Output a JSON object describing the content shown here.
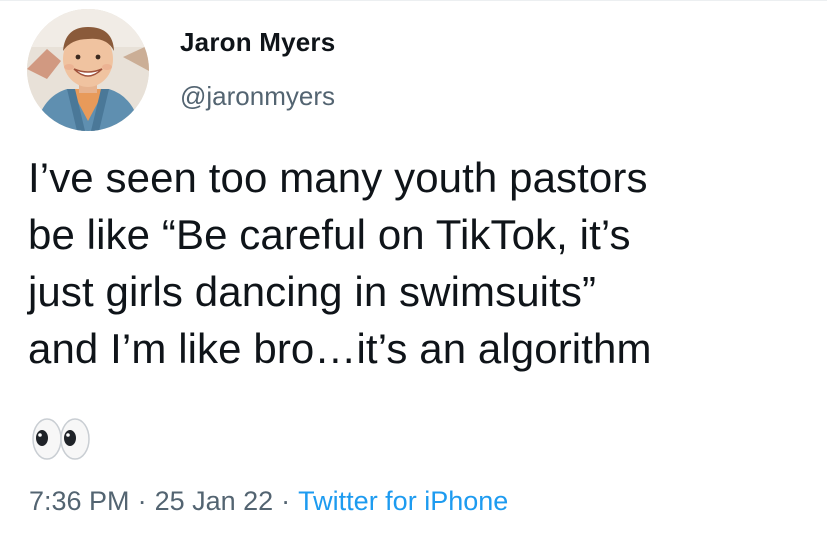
{
  "author": {
    "display_name": "Jaron Myers",
    "handle": "@jaronmyers",
    "avatar_icon": "profile-photo"
  },
  "tweet": {
    "lines": [
      "I’ve seen too many youth pastors",
      "be like “Be careful on TikTok, it’s",
      "just girls dancing in swimsuits”",
      "and I’m like bro…it’s an algorithm"
    ],
    "emoji": "eyes-emoji"
  },
  "meta": {
    "time": "7:36 PM",
    "date": "25 Jan 22",
    "separator": "·",
    "source": "Twitter for iPhone"
  },
  "colors": {
    "text": "#0f1419",
    "secondary": "#536471",
    "link": "#1d9bf0"
  }
}
